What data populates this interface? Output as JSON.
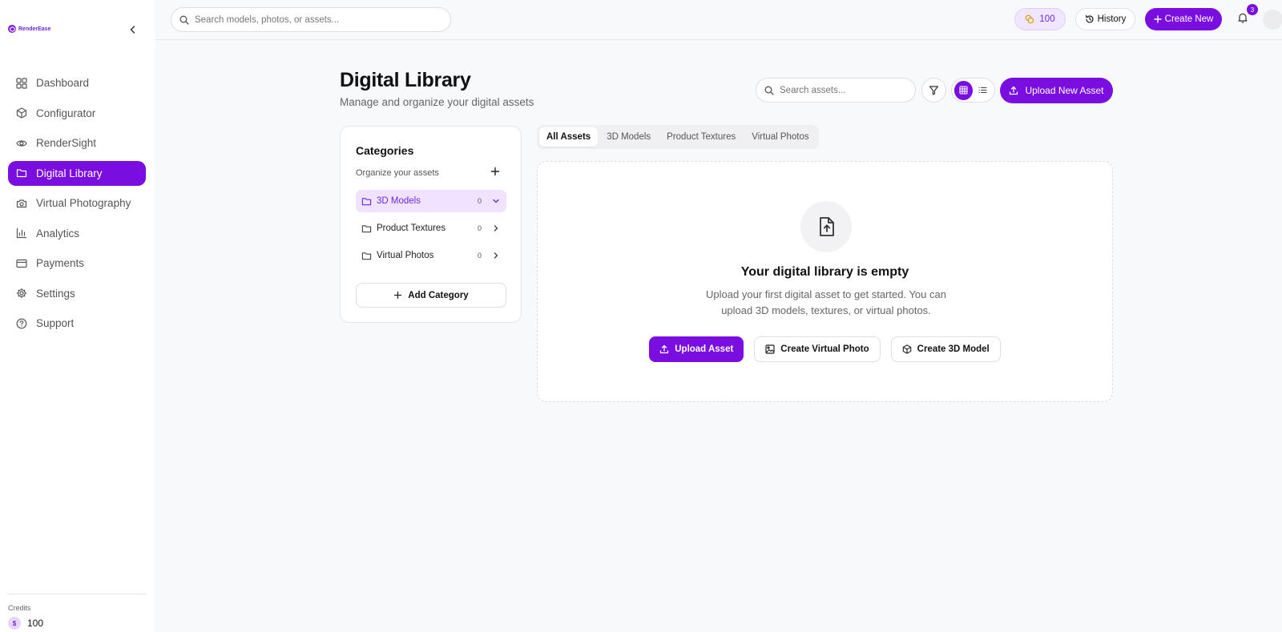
{
  "brand": {
    "name": "RenderEase"
  },
  "topbar": {
    "search_placeholder": "Search models, photos, or assets...",
    "credits": "100",
    "history_label": "History",
    "create_label": "Create New",
    "notifications_count": "3"
  },
  "sidebar": {
    "items": [
      {
        "label": "Dashboard",
        "icon": "grid-icon"
      },
      {
        "label": "Configurator",
        "icon": "cube-icon"
      },
      {
        "label": "RenderSight",
        "icon": "eye-icon"
      },
      {
        "label": "Digital Library",
        "icon": "folder-icon",
        "active": true
      },
      {
        "label": "Virtual Photography",
        "icon": "camera-icon"
      },
      {
        "label": "Analytics",
        "icon": "bar-chart-icon"
      },
      {
        "label": "Payments",
        "icon": "credit-card-icon"
      },
      {
        "label": "Settings",
        "icon": "gear-icon"
      },
      {
        "label": "Support",
        "icon": "help-circle-icon"
      }
    ],
    "credits_label": "Credits",
    "credits_symbol": "$",
    "credits_value": "100"
  },
  "page": {
    "title": "Digital Library",
    "subtitle": "Manage and organize your digital assets",
    "search_placeholder": "Search assets...",
    "upload_label": "Upload New Asset",
    "view_mode": "grid"
  },
  "categories": {
    "title": "Categories",
    "subtitle": "Organize your assets",
    "items": [
      {
        "name": "3D Models",
        "count": "0",
        "active": true
      },
      {
        "name": "Product Textures",
        "count": "0"
      },
      {
        "name": "Virtual Photos",
        "count": "0"
      }
    ],
    "add_label": "Add Category"
  },
  "tabs": [
    "All Assets",
    "3D Models",
    "Product Textures",
    "Virtual Photos"
  ],
  "active_tab": "All Assets",
  "empty_state": {
    "title": "Your digital library is empty",
    "description": "Upload your first digital asset to get started. You can upload 3D models, textures, or virtual photos.",
    "actions": [
      "Upload Asset",
      "Create Virtual Photo",
      "Create 3D Model"
    ]
  },
  "colors": {
    "accent": "#7a0ee0",
    "accent_light": "#f1e3ff",
    "background": "#f8f9fb"
  }
}
